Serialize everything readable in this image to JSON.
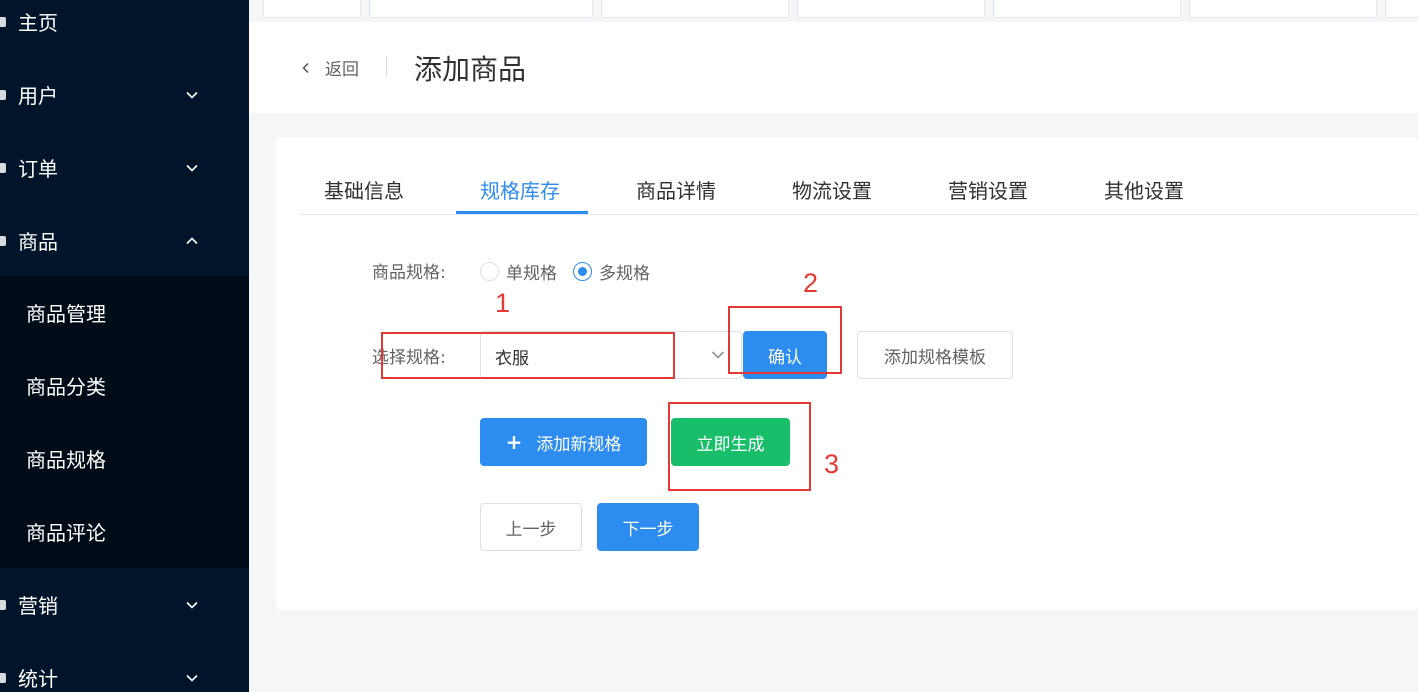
{
  "sidebar": {
    "menu": [
      {
        "label": "主页",
        "icon": "home-icon"
      },
      {
        "label": "用户",
        "icon": "user-icon",
        "chevron": "chevron-down-icon"
      },
      {
        "label": "订单",
        "icon": "order-icon",
        "chevron": "chevron-down-icon"
      },
      {
        "label": "商品",
        "icon": "goods-icon",
        "chevron": "chevron-up-icon"
      },
      {
        "label": "营销",
        "icon": "marketing-icon",
        "chevron": "chevron-down-icon"
      },
      {
        "label": "统计",
        "icon": "stats-icon",
        "chevron": "chevron-down-icon"
      }
    ],
    "submenu": [
      {
        "label": "商品管理"
      },
      {
        "label": "商品分类"
      },
      {
        "label": "商品规格"
      },
      {
        "label": "商品评论"
      }
    ]
  },
  "header": {
    "back_label": "返回",
    "title": "添加商品"
  },
  "tabs": [
    {
      "label": "基础信息"
    },
    {
      "label": "规格库存"
    },
    {
      "label": "商品详情"
    },
    {
      "label": "物流设置"
    },
    {
      "label": "营销设置"
    },
    {
      "label": "其他设置"
    }
  ],
  "form": {
    "spec_label": "商品规格:",
    "spec_options": [
      {
        "label": "单规格"
      },
      {
        "label": "多规格"
      }
    ],
    "select_label": "选择规格:",
    "select_value": "衣服",
    "confirm_label": "确认",
    "add_template_label": "添加规格模板",
    "add_spec_label": "添加新规格",
    "generate_label": "立即生成",
    "prev_label": "上一步",
    "next_label": "下一步"
  },
  "annotations": [
    "1",
    "2",
    "3"
  ],
  "colors": {
    "sidebar_bg": "#001529",
    "primary": "#2d8cf0",
    "success": "#19be6b",
    "annotation": "#e53935"
  }
}
